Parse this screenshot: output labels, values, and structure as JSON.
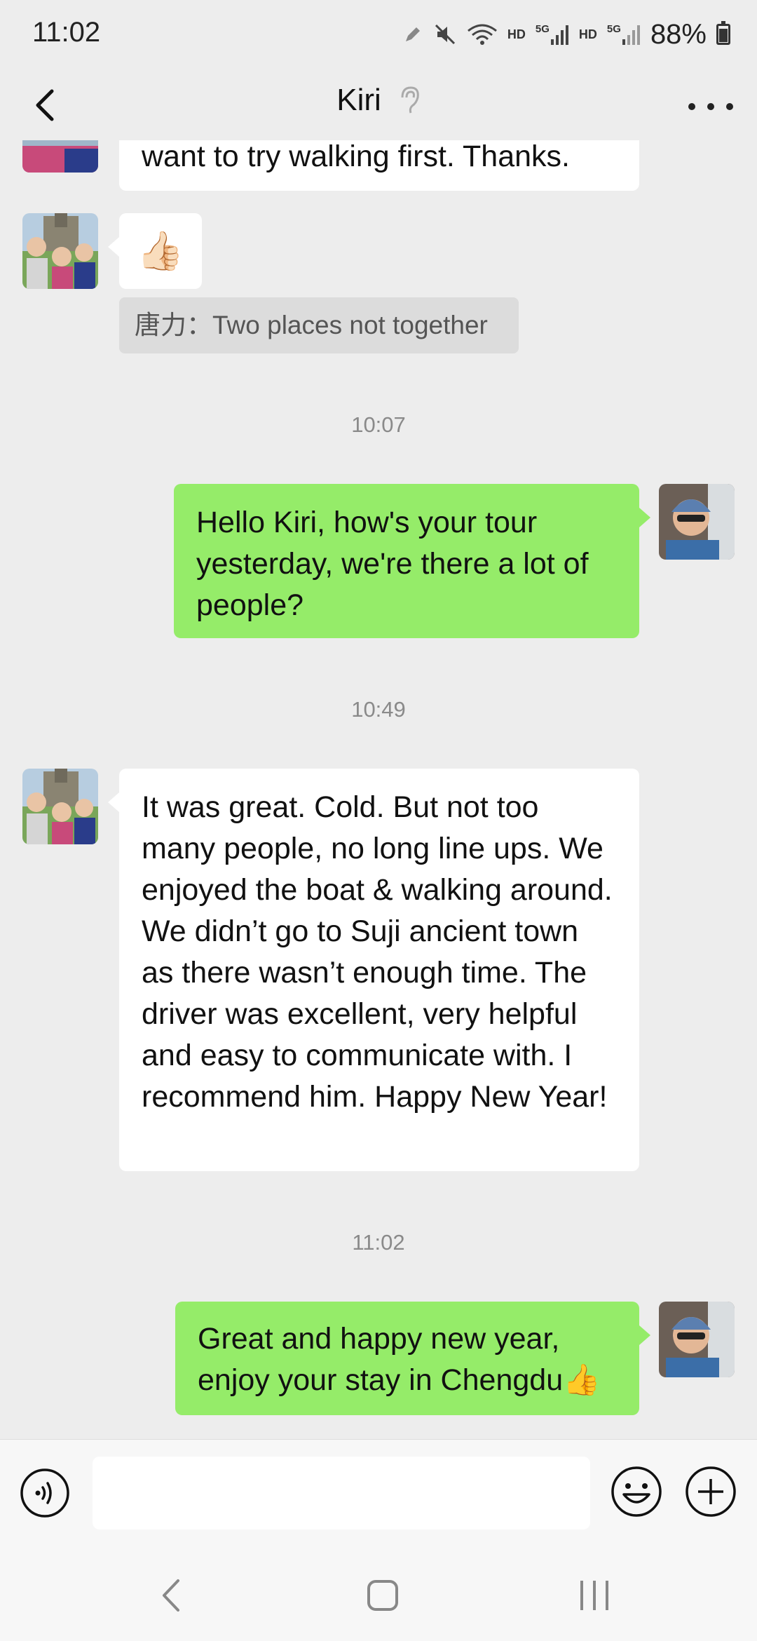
{
  "status_bar": {
    "time": "11:02",
    "network_labels": [
      "HD",
      "5G",
      "HD",
      "5G"
    ],
    "battery_percent": "88%"
  },
  "header": {
    "title": "Kiri"
  },
  "messages": [
    {
      "side": "left",
      "text": "want to try walking first. Thanks."
    },
    {
      "side": "left",
      "emoji": "👍🏻"
    },
    {
      "quote": "唐力：Two places not together"
    },
    {
      "timestamp": "10:07"
    },
    {
      "side": "right",
      "text": "Hello Kiri, how's your tour yesterday, we're there a lot of people?"
    },
    {
      "timestamp": "10:49"
    },
    {
      "side": "left",
      "text": "It was great. Cold. But not too many people, no long line ups. We enjoyed the boat & walking around. We didn’t go to Suji ancient town as there wasn’t enough time. The driver was excellent, very helpful and easy to communicate with. I recommend him. Happy New Year!"
    },
    {
      "timestamp": "11:02"
    },
    {
      "side": "right",
      "text": "Great and happy new year, enjoy your stay in Chengdu👍"
    }
  ],
  "input_bar": {
    "value": "",
    "icons": [
      "voice-icon",
      "emoji-icon",
      "plus-icon"
    ]
  },
  "nav_bar": {
    "icons": [
      "back-icon",
      "home-icon",
      "recents-icon"
    ]
  },
  "colors": {
    "background": "#ededed",
    "sent_bubble": "#95ec69",
    "received_bubble": "#ffffff"
  }
}
